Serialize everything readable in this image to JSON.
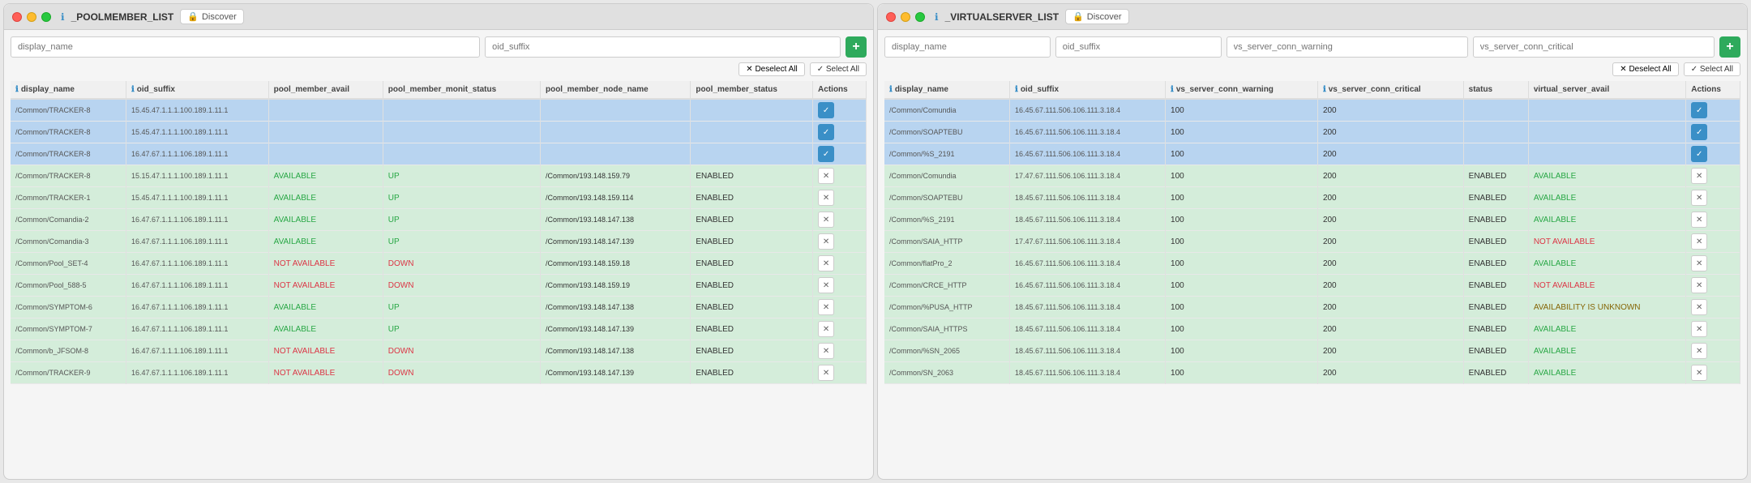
{
  "windows": [
    {
      "id": "pool-member-list",
      "title": "_POOLMEMBER_LIST",
      "discover_label": "Discover",
      "filters": [
        {
          "placeholder": "display_name",
          "size": "wide"
        },
        {
          "placeholder": "oid_suffix",
          "size": "medium"
        }
      ],
      "add_label": "+",
      "deselect_label": "✕ Deselect All",
      "select_label": "✓ Select All",
      "columns": [
        {
          "label": "display_name",
          "has_info": true
        },
        {
          "label": "oid_suffix",
          "has_info": true
        },
        {
          "label": "pool_member_avail",
          "has_info": false
        },
        {
          "label": "pool_member_monit_status",
          "has_info": false
        },
        {
          "label": "pool_member_node_name",
          "has_info": false
        },
        {
          "label": "pool_member_status",
          "has_info": false
        },
        {
          "label": "Actions",
          "has_info": false
        }
      ],
      "rows": [
        {
          "display_name": "/Common/TRACKER-8",
          "oid_suffix": "15.45.47.1.1.1.100.189.1.11.1",
          "avail": "",
          "monit_status": "",
          "node_name": "",
          "status": "",
          "type": "selected"
        },
        {
          "display_name": "/Common/TRACKER-8",
          "oid_suffix": "15.45.47.1.1.1.100.189.1.11.1",
          "avail": "",
          "monit_status": "",
          "node_name": "",
          "status": "",
          "type": "selected"
        },
        {
          "display_name": "/Common/TRACKER-8",
          "oid_suffix": "16.47.67.1.1.1.106.189.1.11.1",
          "avail": "",
          "monit_status": "",
          "node_name": "",
          "status": "",
          "type": "selected"
        },
        {
          "display_name": "/Common/TRACKER-8",
          "oid_suffix": "15.15.47.1.1.1.100.189.1.11.1",
          "avail": "AVAILABLE",
          "monit_status": "UP",
          "node_name": "/Common/193.148.159.79",
          "status": "ENABLED",
          "type": "green"
        },
        {
          "display_name": "/Common/TRACKER-1",
          "oid_suffix": "15.45.47.1.1.1.100.189.1.11.1",
          "avail": "AVAILABLE",
          "monit_status": "UP",
          "node_name": "/Common/193.148.159.114",
          "status": "ENABLED",
          "type": "green"
        },
        {
          "display_name": "/Common/Comandia-2",
          "oid_suffix": "16.47.67.1.1.1.106.189.1.11.1",
          "avail": "AVAILABLE",
          "monit_status": "UP",
          "node_name": "/Common/193.148.147.138",
          "status": "ENABLED",
          "type": "green"
        },
        {
          "display_name": "/Common/Comandia-3",
          "oid_suffix": "16.47.67.1.1.1.106.189.1.11.1",
          "avail": "AVAILABLE",
          "monit_status": "UP",
          "node_name": "/Common/193.148.147.139",
          "status": "ENABLED",
          "type": "green"
        },
        {
          "display_name": "/Common/Pool_SET-4",
          "oid_suffix": "16.47.67.1.1.1.106.189.1.11.1",
          "avail": "NOT AVAILABLE",
          "monit_status": "DOWN",
          "node_name": "/Common/193.148.159.18",
          "status": "ENABLED",
          "type": "green"
        },
        {
          "display_name": "/Common/Pool_588-5",
          "oid_suffix": "16.47.67.1.1.1.106.189.1.11.1",
          "avail": "NOT AVAILABLE",
          "monit_status": "DOWN",
          "node_name": "/Common/193.148.159.19",
          "status": "ENABLED",
          "type": "green"
        },
        {
          "display_name": "/Common/SYMPTOM-6",
          "oid_suffix": "16.47.67.1.1.1.106.189.1.11.1",
          "avail": "AVAILABLE",
          "monit_status": "UP",
          "node_name": "/Common/193.148.147.138",
          "status": "ENABLED",
          "type": "green"
        },
        {
          "display_name": "/Common/SYMPTOM-7",
          "oid_suffix": "16.47.67.1.1.1.106.189.1.11.1",
          "avail": "AVAILABLE",
          "monit_status": "UP",
          "node_name": "/Common/193.148.147.139",
          "status": "ENABLED",
          "type": "green"
        },
        {
          "display_name": "/Common/b_JFSOM-8",
          "oid_suffix": "16.47.67.1.1.1.106.189.1.11.1",
          "avail": "NOT AVAILABLE",
          "monit_status": "DOWN",
          "node_name": "/Common/193.148.147.138",
          "status": "ENABLED",
          "type": "green"
        },
        {
          "display_name": "/Common/TRACKER-9",
          "oid_suffix": "16.47.67.1.1.1.106.189.1.11.1",
          "avail": "NOT AVAILABLE",
          "monit_status": "DOWN",
          "node_name": "/Common/193.148.147.139",
          "status": "ENABLED",
          "type": "green"
        }
      ]
    },
    {
      "id": "virtual-server-list",
      "title": "_VIRTUALSERVER_LIST",
      "discover_label": "Discover",
      "filters": [
        {
          "placeholder": "display_name",
          "size": "narrow"
        },
        {
          "placeholder": "oid_suffix",
          "size": "narrow"
        },
        {
          "placeholder": "vs_server_conn_warning",
          "size": "medium"
        },
        {
          "placeholder": "vs_server_conn_critical",
          "size": "medium"
        }
      ],
      "add_label": "+",
      "deselect_label": "✕ Deselect All",
      "select_label": "✓ Select All",
      "columns": [
        {
          "label": "display_name",
          "has_info": true
        },
        {
          "label": "oid_suffix",
          "has_info": true
        },
        {
          "label": "vs_server_conn_warning",
          "has_info": true
        },
        {
          "label": "vs_server_conn_critical",
          "has_info": true
        },
        {
          "label": "status",
          "has_info": false
        },
        {
          "label": "virtual_server_avail",
          "has_info": false
        },
        {
          "label": "Actions",
          "has_info": false
        }
      ],
      "rows": [
        {
          "display_name": "/Common/Comundia",
          "oid_suffix": "16.45.67.111.506.106.111.3.18.4",
          "warning": "100",
          "critical": "200",
          "status": "",
          "avail": "",
          "type": "selected"
        },
        {
          "display_name": "/Common/SOAPTEBU",
          "oid_suffix": "16.45.67.111.506.106.111.3.18.4",
          "warning": "100",
          "critical": "200",
          "status": "",
          "avail": "",
          "type": "selected"
        },
        {
          "display_name": "/Common/%S_2191",
          "oid_suffix": "16.45.67.111.506.106.111.3.18.4",
          "warning": "100",
          "critical": "200",
          "status": "",
          "avail": "",
          "type": "selected"
        },
        {
          "display_name": "/Common/Comundia",
          "oid_suffix": "17.47.67.111.506.106.111.3.18.4",
          "warning": "100",
          "critical": "200",
          "status": "ENABLED",
          "avail": "AVAILABLE",
          "type": "green"
        },
        {
          "display_name": "/Common/SOAPTEBU",
          "oid_suffix": "18.45.67.111.506.106.111.3.18.4",
          "warning": "100",
          "critical": "200",
          "status": "ENABLED",
          "avail": "AVAILABLE",
          "type": "green"
        },
        {
          "display_name": "/Common/%S_2191",
          "oid_suffix": "18.45.67.111.506.106.111.3.18.4",
          "warning": "100",
          "critical": "200",
          "status": "ENABLED",
          "avail": "AVAILABLE",
          "type": "green"
        },
        {
          "display_name": "/Common/SAIA_HTTP",
          "oid_suffix": "17.47.67.111.506.106.111.3.18.4",
          "warning": "100",
          "critical": "200",
          "status": "ENABLED",
          "avail": "NOT AVAILABLE",
          "type": "green"
        },
        {
          "display_name": "/Common/flatPro_2",
          "oid_suffix": "16.45.67.111.506.106.111.3.18.4",
          "warning": "100",
          "critical": "200",
          "status": "ENABLED",
          "avail": "AVAILABLE",
          "type": "green"
        },
        {
          "display_name": "/Common/CRCE_HTTP",
          "oid_suffix": "16.45.67.111.506.106.111.3.18.4",
          "warning": "100",
          "critical": "200",
          "status": "ENABLED",
          "avail": "NOT AVAILABLE",
          "type": "green"
        },
        {
          "display_name": "/Common/%PUSA_HTTP",
          "oid_suffix": "18.45.67.111.506.106.111.3.18.4",
          "warning": "100",
          "critical": "200",
          "status": "ENABLED",
          "avail": "AVAILABILITY IS UNKNOWN",
          "type": "green"
        },
        {
          "display_name": "/Common/SAIA_HTTPS",
          "oid_suffix": "18.45.67.111.506.106.111.3.18.4",
          "warning": "100",
          "critical": "200",
          "status": "ENABLED",
          "avail": "AVAILABLE",
          "type": "green"
        },
        {
          "display_name": "/Common/%SN_2065",
          "oid_suffix": "18.45.67.111.506.106.111.3.18.4",
          "warning": "100",
          "critical": "200",
          "status": "ENABLED",
          "avail": "AVAILABLE",
          "type": "green"
        },
        {
          "display_name": "/Common/SN_2063",
          "oid_suffix": "18.45.67.111.506.106.111.3.18.4",
          "warning": "100",
          "critical": "200",
          "status": "ENABLED",
          "avail": "AVAILABLE",
          "type": "green"
        }
      ]
    }
  ]
}
